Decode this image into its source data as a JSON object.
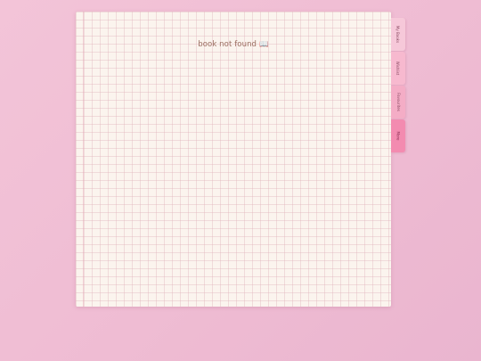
{
  "main": {
    "message": "book not found",
    "message_icon": "open-book-icon",
    "message_icon_glyph": "📖"
  },
  "tabs": [
    {
      "label": "My Books"
    },
    {
      "label": "Wishlist"
    },
    {
      "label": "Favourites"
    },
    {
      "label": "More"
    }
  ],
  "colors": {
    "background": "#efbcd3",
    "paper": "#fbf4ee",
    "grid_line": "#deaab4",
    "text": "#9a6e60",
    "tab_active": "#f38bb0"
  }
}
